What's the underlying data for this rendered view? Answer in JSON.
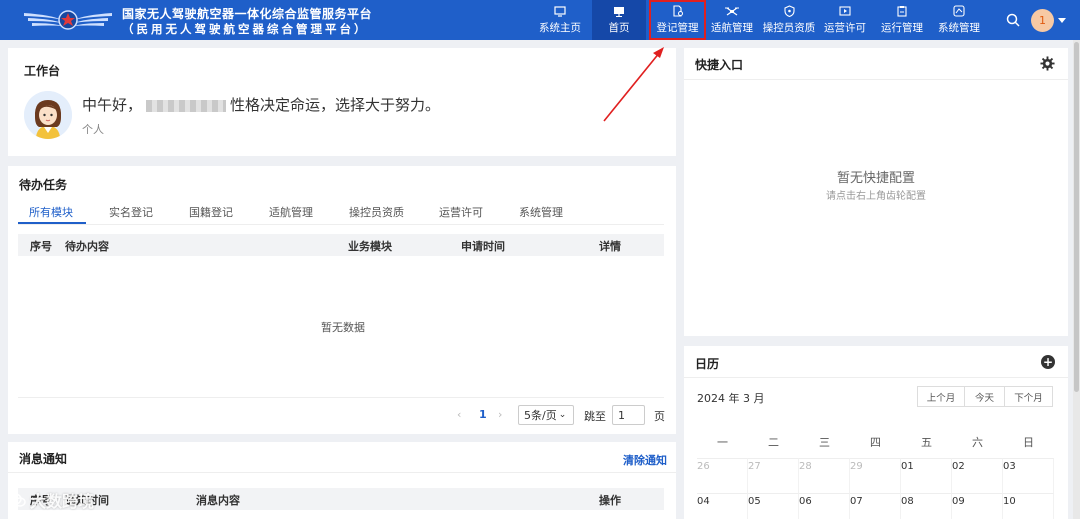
{
  "header": {
    "title_line1": "国家无人驾驶航空器一体化综合监管服务平台",
    "title_line2": "（民用无人驾驶航空器综合管理平台）",
    "nav": [
      {
        "label": "系统主页",
        "icon": "monitor-icon"
      },
      {
        "label": "首页",
        "icon": "desktop-icon"
      },
      {
        "label": "登记管理",
        "icon": "document-settings-icon"
      },
      {
        "label": "适航管理",
        "icon": "drone-icon"
      },
      {
        "label": "操控员资质",
        "icon": "shield-icon"
      },
      {
        "label": "运营许可",
        "icon": "play-card-icon"
      },
      {
        "label": "运行管理",
        "icon": "clipboard-icon"
      },
      {
        "label": "系统管理",
        "icon": "map-icon"
      }
    ],
    "avatar_text": "1",
    "accent": "#1f5fc9"
  },
  "workbench": {
    "title": "工作台",
    "greeting_prefix": "中午好，",
    "greeting_suffix": "性格决定命运，选择大于努力。",
    "role": "个人"
  },
  "todo": {
    "title": "待办任务",
    "tabs": [
      "所有模块",
      "实名登记",
      "国籍登记",
      "适航管理",
      "操控员资质",
      "运营许可",
      "系统管理"
    ],
    "columns": [
      "序号",
      "待办内容",
      "业务模块",
      "申请时间",
      "详情"
    ],
    "empty_text": "暂无数据",
    "pager": {
      "current_page": "1",
      "page_size": "5条/页",
      "jump_label": "跳至",
      "jump_value": "1",
      "page_unit": "页"
    }
  },
  "messages": {
    "title": "消息通知",
    "clear_label": "清除通知",
    "columns": [
      "序号",
      "通知时间",
      "消息内容",
      "操作"
    ]
  },
  "quick": {
    "title": "快捷入口",
    "empty_title": "暂无快捷配置",
    "empty_hint": "请点击右上角齿轮配置"
  },
  "calendar": {
    "title": "日历",
    "month_label": "2024 年 3 月",
    "prev_label": "上个月",
    "today_label": "今天",
    "next_label": "下个月",
    "weekdays": [
      "一",
      "二",
      "三",
      "四",
      "五",
      "六",
      "日"
    ],
    "week1": [
      "26",
      "27",
      "28",
      "29",
      "01",
      "02",
      "03"
    ],
    "week2": [
      "04",
      "05",
      "06",
      "07",
      "08",
      "09",
      "10"
    ]
  },
  "watermark": "大数跨境"
}
